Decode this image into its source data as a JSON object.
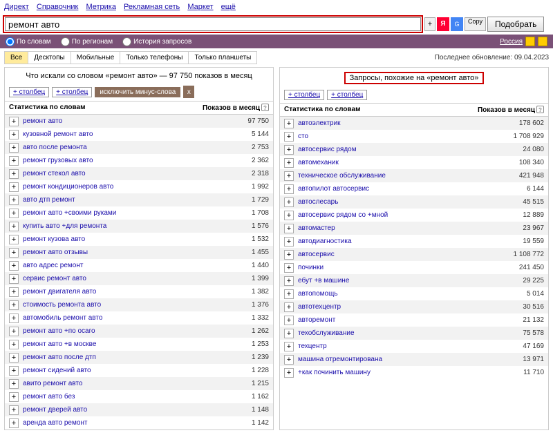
{
  "topnav": [
    "Директ",
    "Справочник",
    "Метрика",
    "Рекламная сеть",
    "Маркет",
    "ещё"
  ],
  "search": {
    "value": "ремонт авто",
    "plus": "+",
    "ya": "Я",
    "g": "G",
    "copy": "Copy",
    "submit": "Подобрать"
  },
  "purple": {
    "opts": [
      "По словам",
      "По регионам",
      "История запросов"
    ],
    "region": "Россия"
  },
  "devices": {
    "tabs": [
      "Все",
      "Десктопы",
      "Мобильные",
      "Только телефоны",
      "Только планшеты"
    ],
    "updated": "Последнее обновление: 09.04.2023"
  },
  "left": {
    "title": "Что искали со словом «ремонт авто» — 97 750 показов в месяц",
    "add_col": "+ столбец",
    "exclude": "исключить минус-слова",
    "x": "x",
    "stat_head": "Статистика по словам",
    "count_head": "Показов в месяц",
    "rows": [
      {
        "kw": "ремонт авто",
        "cnt": "97 750"
      },
      {
        "kw": "кузовной ремонт авто",
        "cnt": "5 144"
      },
      {
        "kw": "авто после ремонта",
        "cnt": "2 753"
      },
      {
        "kw": "ремонт грузовых авто",
        "cnt": "2 362"
      },
      {
        "kw": "ремонт стекол авто",
        "cnt": "2 318"
      },
      {
        "kw": "ремонт кондиционеров авто",
        "cnt": "1 992"
      },
      {
        "kw": "авто дтп ремонт",
        "cnt": "1 729"
      },
      {
        "kw": "ремонт авто +своими руками",
        "cnt": "1 708"
      },
      {
        "kw": "купить авто +для ремонта",
        "cnt": "1 576"
      },
      {
        "kw": "ремонт кузова авто",
        "cnt": "1 532"
      },
      {
        "kw": "ремонт авто отзывы",
        "cnt": "1 455"
      },
      {
        "kw": "авто адрес ремонт",
        "cnt": "1 440"
      },
      {
        "kw": "сервис ремонт авто",
        "cnt": "1 399"
      },
      {
        "kw": "ремонт двигателя авто",
        "cnt": "1 382"
      },
      {
        "kw": "стоимость ремонта авто",
        "cnt": "1 376"
      },
      {
        "kw": "автомобиль ремонт авто",
        "cnt": "1 332"
      },
      {
        "kw": "ремонт авто +по осаго",
        "cnt": "1 262"
      },
      {
        "kw": "ремонт авто +в москве",
        "cnt": "1 253"
      },
      {
        "kw": "ремонт авто после дтп",
        "cnt": "1 239"
      },
      {
        "kw": "ремонт сидений авто",
        "cnt": "1 228"
      },
      {
        "kw": "авито ремонт авто",
        "cnt": "1 215"
      },
      {
        "kw": "ремонт авто без",
        "cnt": "1 162"
      },
      {
        "kw": "ремонт дверей авто",
        "cnt": "1 148"
      },
      {
        "kw": "аренда авто ремонт",
        "cnt": "1 142"
      }
    ]
  },
  "right": {
    "title": "Запросы, похожие на «ремонт авто»",
    "add_col": "+ столбец",
    "stat_head": "Статистика по словам",
    "count_head": "Показов в месяц",
    "rows": [
      {
        "kw": "автоэлектрик",
        "cnt": "178 602"
      },
      {
        "kw": "сто",
        "cnt": "1 708 929"
      },
      {
        "kw": "автосервис рядом",
        "cnt": "24 080"
      },
      {
        "kw": "автомеханик",
        "cnt": "108 340"
      },
      {
        "kw": "техническое обслуживание",
        "cnt": "421 948"
      },
      {
        "kw": "автопилот автосервис",
        "cnt": "6 144"
      },
      {
        "kw": "автослесарь",
        "cnt": "45 515"
      },
      {
        "kw": "автосервис рядом со +мной",
        "cnt": "12 889"
      },
      {
        "kw": "автомастер",
        "cnt": "23 967"
      },
      {
        "kw": "автодиагностика",
        "cnt": "19 559"
      },
      {
        "kw": "автосервис",
        "cnt": "1 108 772"
      },
      {
        "kw": "починки",
        "cnt": "241 450"
      },
      {
        "kw": "ебут +в машине",
        "cnt": "29 225"
      },
      {
        "kw": "автопомощь",
        "cnt": "5 014"
      },
      {
        "kw": "автотехцентр",
        "cnt": "30 516"
      },
      {
        "kw": "авторемонт",
        "cnt": "21 132"
      },
      {
        "kw": "техобслуживание",
        "cnt": "75 578"
      },
      {
        "kw": "техцентр",
        "cnt": "47 169"
      },
      {
        "kw": "машина отремонтирована",
        "cnt": "13 971"
      },
      {
        "kw": "+как починить машину",
        "cnt": "11 710"
      }
    ]
  }
}
